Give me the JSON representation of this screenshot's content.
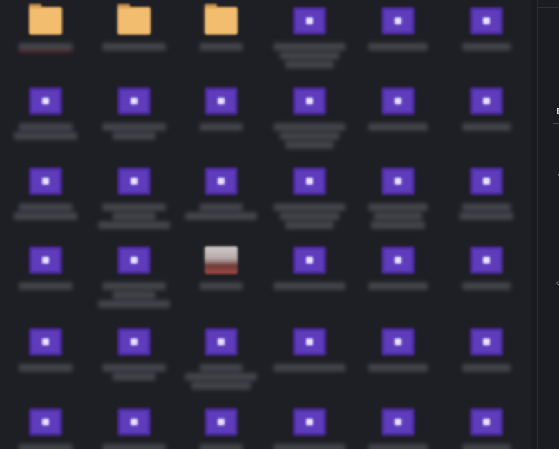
{
  "window": {
    "title": ""
  },
  "grid": {
    "items": [
      {
        "type": "folder",
        "name": "",
        "selected": true
      },
      {
        "type": "folder",
        "name": ""
      },
      {
        "type": "folder",
        "name": ""
      },
      {
        "type": "media",
        "name": ""
      },
      {
        "type": "media",
        "name": ""
      },
      {
        "type": "media",
        "name": ""
      },
      {
        "type": "media",
        "name": ""
      },
      {
        "type": "media",
        "name": ""
      },
      {
        "type": "media",
        "name": ""
      },
      {
        "type": "media",
        "name": ""
      },
      {
        "type": "media",
        "name": ""
      },
      {
        "type": "media",
        "name": ""
      },
      {
        "type": "media",
        "name": ""
      },
      {
        "type": "media",
        "name": ""
      },
      {
        "type": "media",
        "name": ""
      },
      {
        "type": "media",
        "name": ""
      },
      {
        "type": "media",
        "name": ""
      },
      {
        "type": "media",
        "name": ""
      },
      {
        "type": "media",
        "name": ""
      },
      {
        "type": "media",
        "name": ""
      },
      {
        "type": "photo",
        "name": ""
      },
      {
        "type": "media",
        "name": ""
      },
      {
        "type": "media",
        "name": ""
      },
      {
        "type": "media",
        "name": ""
      },
      {
        "type": "media",
        "name": ""
      },
      {
        "type": "media",
        "name": ""
      },
      {
        "type": "media",
        "name": ""
      },
      {
        "type": "media",
        "name": ""
      },
      {
        "type": "media",
        "name": ""
      },
      {
        "type": "media",
        "name": ""
      },
      {
        "type": "media",
        "name": ""
      },
      {
        "type": "media",
        "name": ""
      },
      {
        "type": "media",
        "name": ""
      },
      {
        "type": "media",
        "name": ""
      },
      {
        "type": "media",
        "name": ""
      },
      {
        "type": "media",
        "name": ""
      }
    ]
  },
  "side_panel": {
    "heading_letter": "B",
    "lower_letter": "c"
  },
  "colors": {
    "background": "#1e1f24",
    "folder": "#f2bd6e",
    "media_icon": "#5e3cbc",
    "selection_underline": "#5b1c22"
  }
}
